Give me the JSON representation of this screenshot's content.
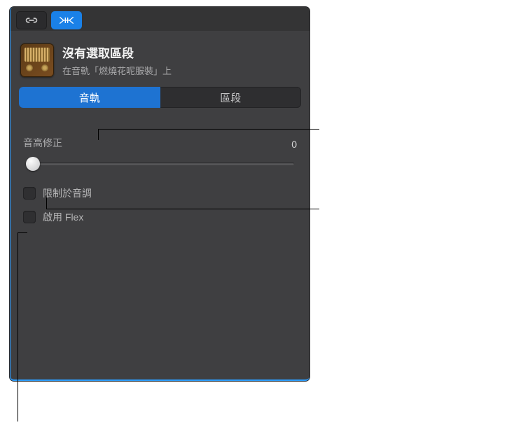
{
  "header": {
    "title": "沒有選取區段",
    "subtitle": "在音軌「燃燒花呢服裝」上"
  },
  "tabs": {
    "track": "音軌",
    "region": "區段"
  },
  "pitch": {
    "label": "音高修正",
    "value": "0"
  },
  "checkboxes": {
    "limitToKey": "限制於音調",
    "enableFlex": "啟用 Flex"
  }
}
